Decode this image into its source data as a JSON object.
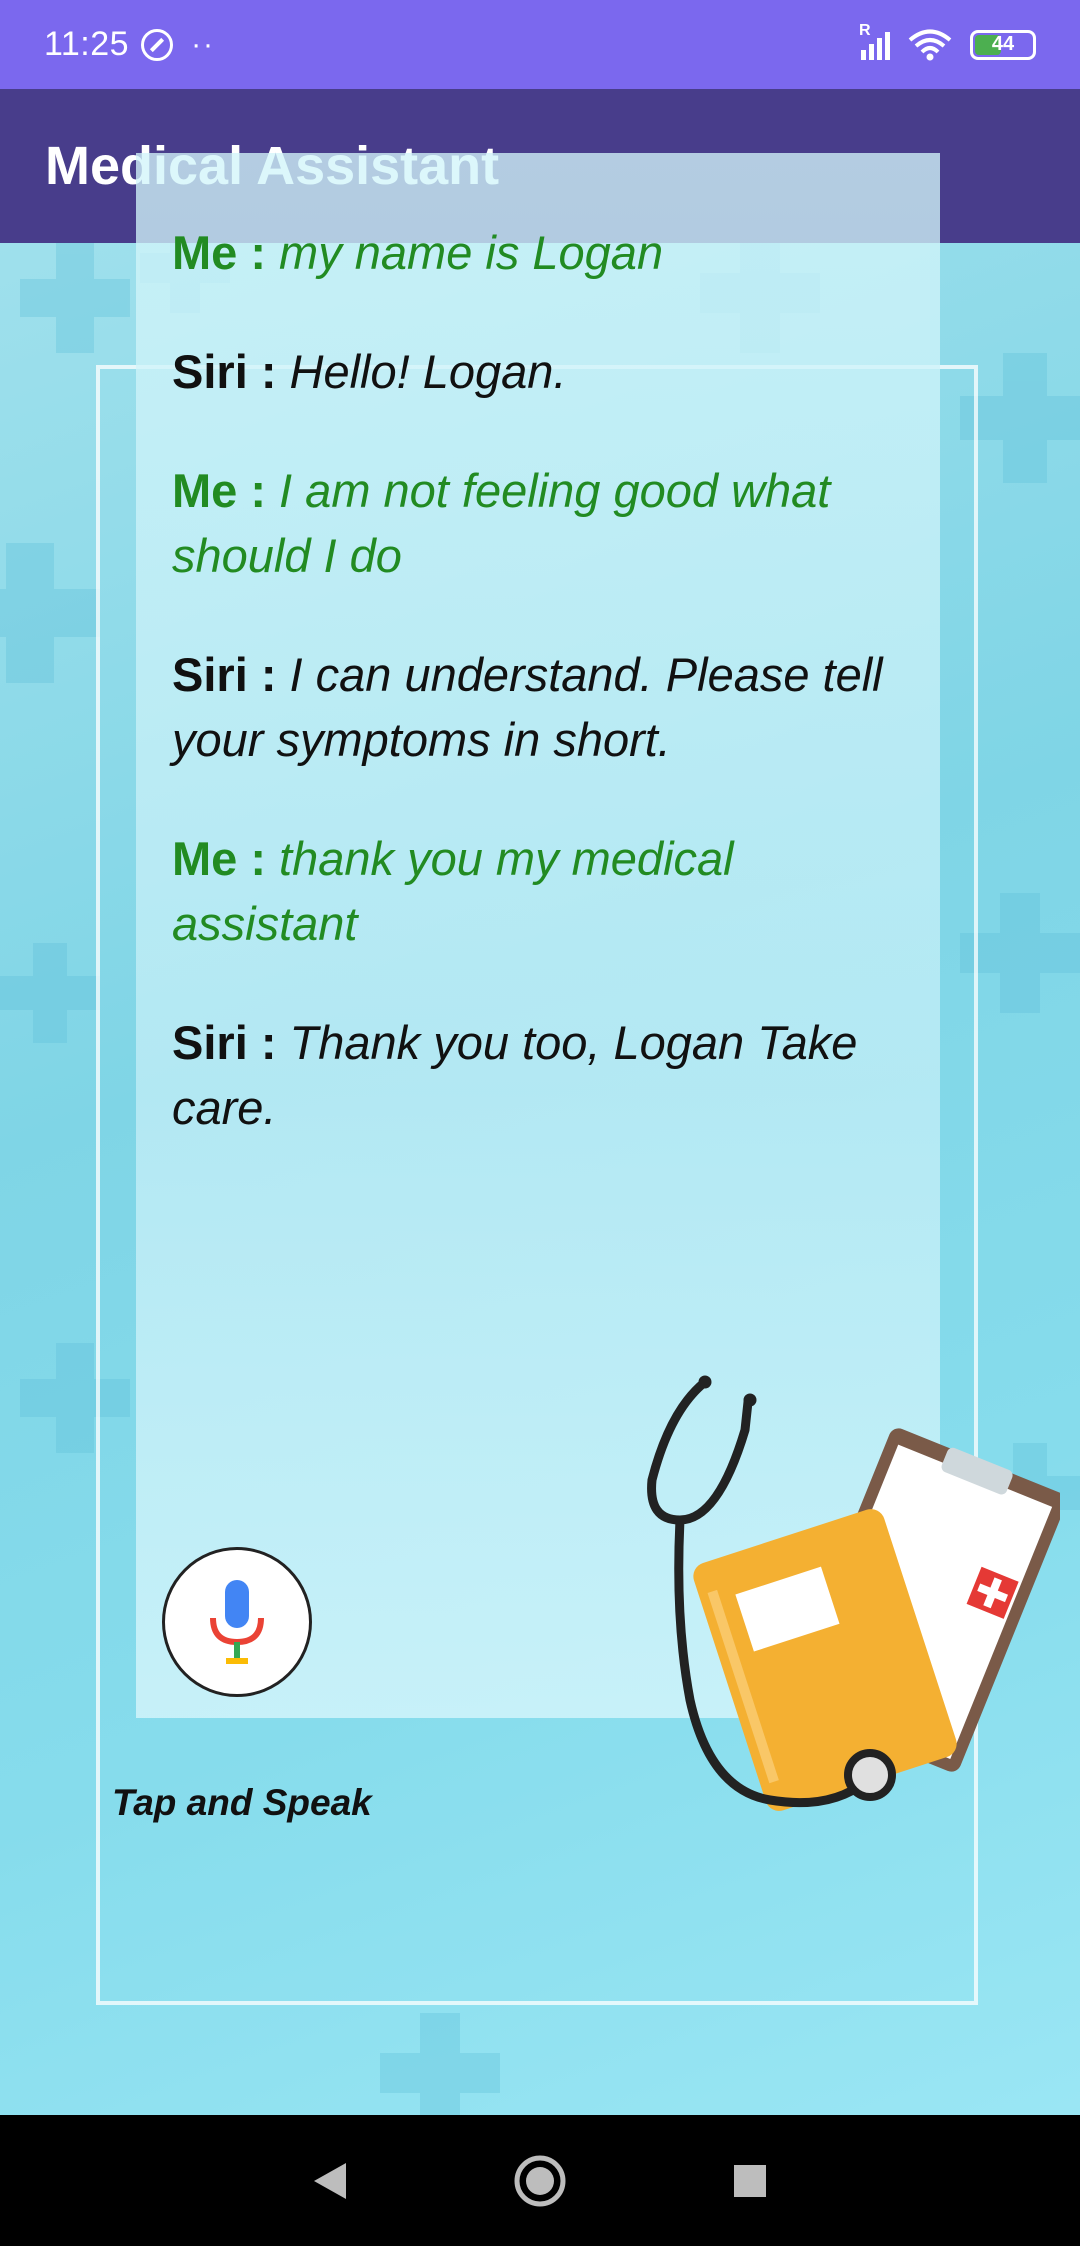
{
  "status_bar": {
    "time": "11:25",
    "dots": "··",
    "signal_label": "R",
    "battery_level": "44",
    "battery_color": "#4caf50"
  },
  "app_bar": {
    "title": "Medical Assistant",
    "color": "#483d8b"
  },
  "conversation": [
    {
      "speaker": "Me :",
      "text": " my name is Logan",
      "role": "me"
    },
    {
      "speaker": "Siri :",
      "text": " Hello! Logan.",
      "role": "siri"
    },
    {
      "speaker": "Me :",
      "text": " I am not feeling good what should I do",
      "role": "me"
    },
    {
      "speaker": "Siri :",
      "text": " I can understand. Please tell your symptoms in short.",
      "role": "siri"
    },
    {
      "speaker": "Me :",
      "text": " thank you my medical assistant",
      "role": "me"
    },
    {
      "speaker": "Siri :",
      "text": " Thank you too, Logan Take care.",
      "role": "siri"
    }
  ],
  "mic": {
    "icon": "microphone-icon",
    "label": "Tap and Speak"
  },
  "nav_bar": {
    "back_icon": "back-triangle-icon",
    "home_icon": "home-circle-icon",
    "recents_icon": "recents-square-icon"
  },
  "colors": {
    "me_text": "#228b22",
    "siri_text": "#111111",
    "status_bar": "#7b68ee"
  }
}
